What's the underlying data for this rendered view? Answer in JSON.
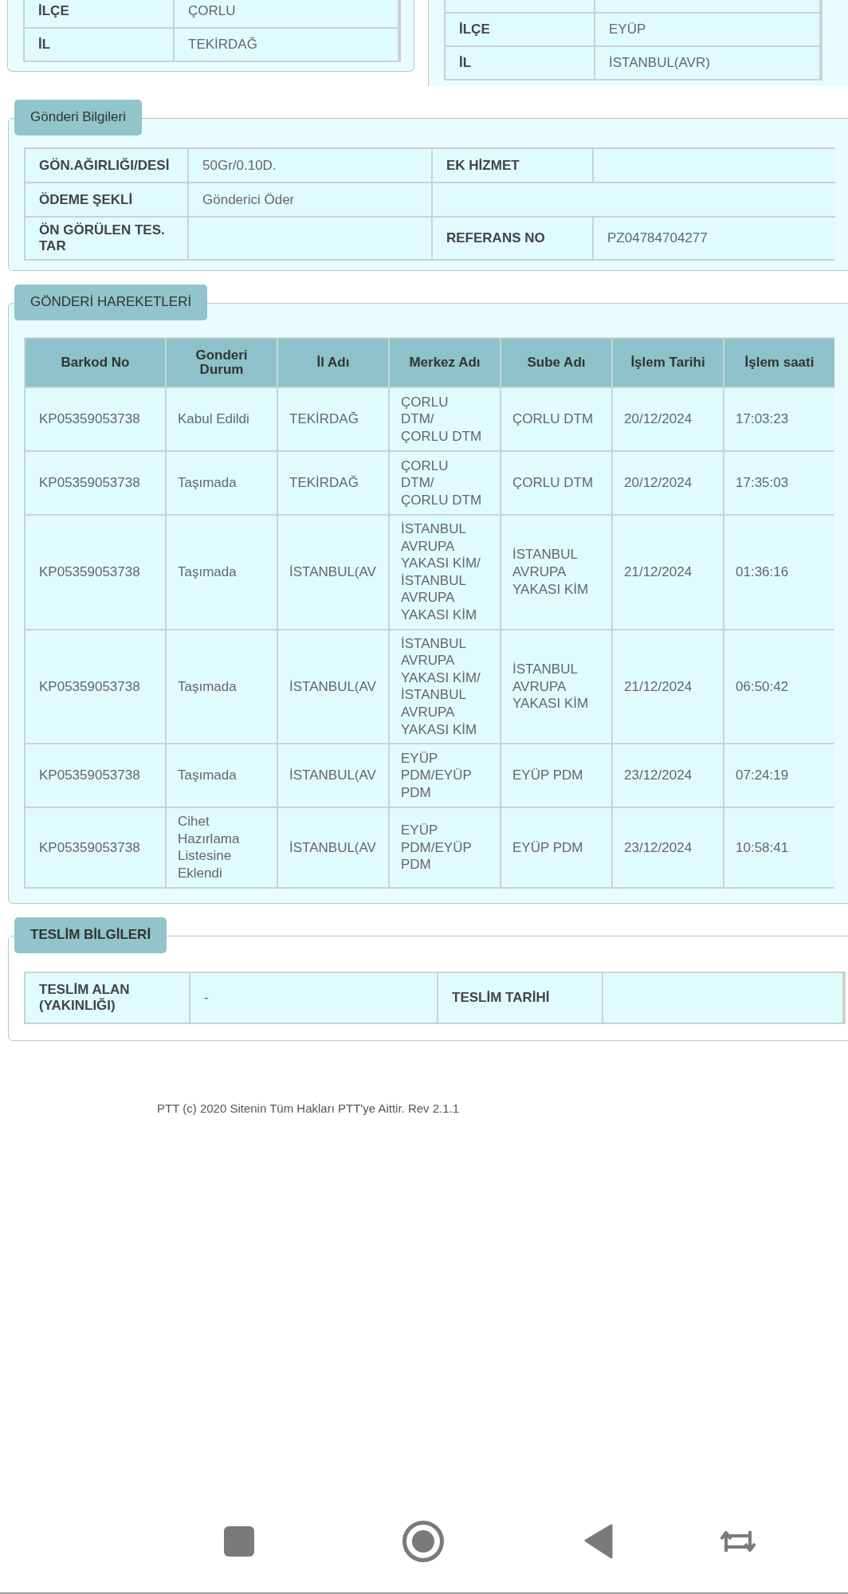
{
  "sender_address": {
    "rows": [
      {
        "label": "İLÇE",
        "value": "ÇORLU"
      },
      {
        "label": "İL",
        "value": "TEKİRDAĞ"
      }
    ]
  },
  "receiver_address": {
    "rows": [
      {
        "label": "İLÇE",
        "value": "EYÜP"
      },
      {
        "label": "İL",
        "value": "İSTANBUL(AVR)"
      }
    ]
  },
  "shipment_info": {
    "title": "Gönderi Bilgileri",
    "rows": [
      [
        {
          "kind": "label",
          "text": "GÖN.AĞIRLIĞI/DESİ"
        },
        {
          "kind": "value",
          "text": "50Gr/0.10D."
        },
        {
          "kind": "label",
          "text": "EK HİZMET"
        },
        {
          "kind": "empty"
        }
      ],
      [
        {
          "kind": "label",
          "text": "ÖDEME ŞEKLİ"
        },
        {
          "kind": "value",
          "text": "Gönderici Öder"
        },
        {
          "kind": "empty-wide"
        }
      ],
      [
        {
          "kind": "label",
          "text": "ÖN GÖRÜLEN TES. TAR"
        },
        {
          "kind": "empty"
        },
        {
          "kind": "label",
          "text": "REFERANS NO"
        },
        {
          "kind": "value",
          "text": "PZ04784704277"
        }
      ]
    ]
  },
  "movements": {
    "title": "GÖNDERİ HAREKETLERİ",
    "columns": [
      "Barkod No",
      "Gonderi Durum",
      "İl Adı",
      "Merkez Adı",
      "Sube Adı",
      "İşlem Tarihi",
      "İşlem saati"
    ],
    "rows": [
      [
        "KP05359053738",
        "Kabul Edildi",
        "TEKİRDAĞ",
        "ÇORLU DTM/ ÇORLU DTM",
        "ÇORLU DTM",
        "20/12/2024",
        "17:03:23"
      ],
      [
        "KP05359053738",
        "Taşımada",
        "TEKİRDAĞ",
        "ÇORLU DTM/ ÇORLU DTM",
        "ÇORLU DTM",
        "20/12/2024",
        "17:35:03"
      ],
      [
        "KP05359053738",
        "Taşımada",
        "İSTANBUL(AV",
        "İSTANBUL AVRUPA YAKASI KİM/ İSTANBUL AVRUPA YAKASI KİM",
        "İSTANBUL AVRUPA YAKASI KİM",
        "21/12/2024",
        "01:36:16"
      ],
      [
        "KP05359053738",
        "Taşımada",
        "İSTANBUL(AV",
        "İSTANBUL AVRUPA YAKASI KİM/ İSTANBUL AVRUPA YAKASI KİM",
        "İSTANBUL AVRUPA YAKASI KİM",
        "21/12/2024",
        "06:50:42"
      ],
      [
        "KP05359053738",
        "Taşımada",
        "İSTANBUL(AV",
        "EYÜP PDM/EYÜP PDM",
        "EYÜP PDM",
        "23/12/2024",
        "07:24:19"
      ],
      [
        "KP05359053738",
        "Cihet Hazırlama Listesine Eklendi",
        "İSTANBUL(AV",
        "EYÜP PDM/EYÜP PDM",
        "EYÜP PDM",
        "23/12/2024",
        "10:58:41"
      ]
    ]
  },
  "delivery_info": {
    "title": "TESLİM BİLGİLERİ",
    "rows": [
      [
        {
          "kind": "label",
          "text": "TESLİM ALAN (YAKINLIĞI)"
        },
        {
          "kind": "value",
          "text": "-"
        },
        {
          "kind": "label",
          "text": "TESLİM TARİHİ"
        },
        {
          "kind": "empty"
        }
      ]
    ]
  },
  "footer": {
    "text": "PTT (c) 2020 Sitenin Tüm Hakları PTT'ye Aittir. Rev 2.1.1"
  }
}
